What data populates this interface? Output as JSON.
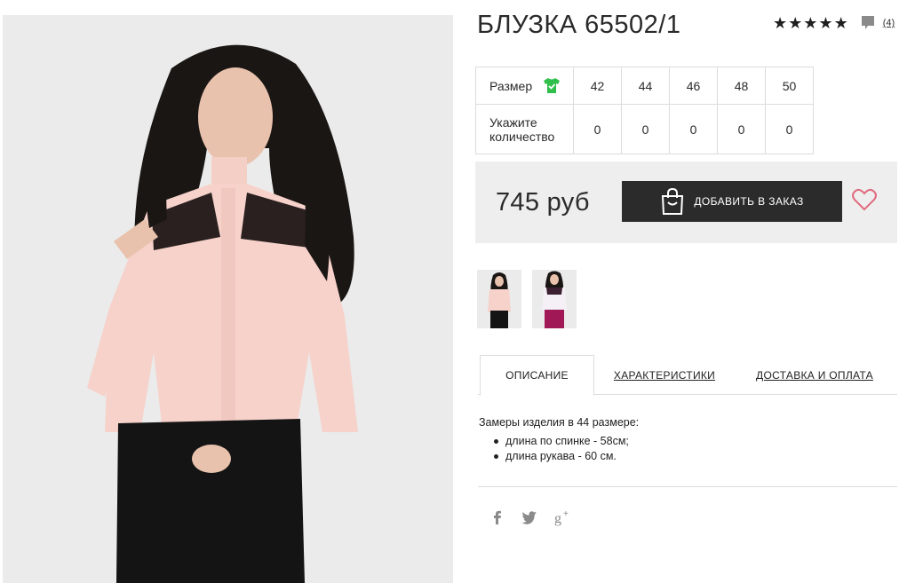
{
  "product": {
    "title": "БЛУЗКА 65502/1",
    "rating_stars": 5,
    "review_count": "(4)"
  },
  "size_table": {
    "size_label": "Размер",
    "quantity_label": "Укажите количество",
    "sizes": [
      "42",
      "44",
      "46",
      "48",
      "50"
    ],
    "quantities": [
      "0",
      "0",
      "0",
      "0",
      "0"
    ]
  },
  "purchase": {
    "price": "745 руб",
    "add_to_order_label": "ДОБАВИТЬ В ЗАКАЗ"
  },
  "tabs": [
    {
      "label": "ОПИСАНИЕ",
      "active": true
    },
    {
      "label": "ХАРАКТЕРИСТИКИ",
      "active": false
    },
    {
      "label": "ДОСТАВКА И ОПЛАТА",
      "active": false
    }
  ],
  "description": {
    "intro": "Замеры изделия в 44 размере:",
    "items": [
      "длина по спинке - 58см;",
      "длина рукава - 60 см."
    ]
  },
  "icons": {
    "star": "star-icon",
    "comment": "comment-icon",
    "shirt_check": "tshirt-check-icon",
    "bag": "shopping-bag-icon",
    "heart": "heart-icon",
    "social": [
      "facebook-icon",
      "twitter-icon",
      "google-plus-icon"
    ]
  },
  "colors": {
    "dark": "#2b2b2b",
    "panel_bg": "#eeeeee",
    "border": "#dcdcdc",
    "accent_green": "#2fbf4a",
    "heart_pink": "#e06b7f",
    "social_grey": "#8a8a8a"
  }
}
